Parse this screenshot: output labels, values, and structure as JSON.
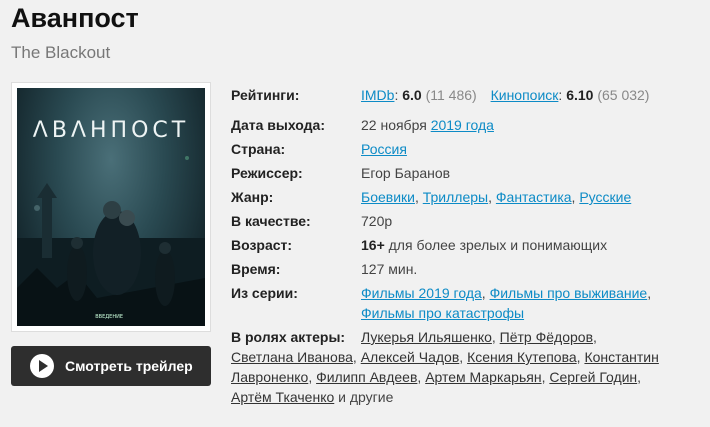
{
  "movie": {
    "title": "Аванпост",
    "original_title": "The Blackout",
    "poster_title": "ΛВΛНПОСТ",
    "poster_badge": "ВВЕДЕНИЕ"
  },
  "trailer_button": {
    "label": "Смотреть трейлер",
    "icon": "play-icon"
  },
  "ratings": {
    "label": "Рейтинги:",
    "imdb_name": "IMDb",
    "imdb_score": "6.0",
    "imdb_votes": "(11 486)",
    "kp_name": "Кинопоиск",
    "kp_score": "6.10",
    "kp_votes": "(65 032)"
  },
  "release": {
    "label": "Дата выхода:",
    "date": "22 ноября",
    "year_link": "2019 года"
  },
  "country": {
    "label": "Страна:",
    "value": "Россия"
  },
  "director": {
    "label": "Режиссер:",
    "value": "Егор Баранов"
  },
  "genre": {
    "label": "Жанр:",
    "items": [
      "Боевики",
      "Триллеры",
      "Фантастика",
      "Русские"
    ]
  },
  "quality": {
    "label": "В качестве:",
    "value": "720p"
  },
  "age": {
    "label": "Возраст:",
    "rating": "16+",
    "text": "для более зрелых и понимающих"
  },
  "duration": {
    "label": "Время:",
    "value": "127 мин."
  },
  "series": {
    "label": "Из серии:",
    "items": [
      "Фильмы 2019 года",
      "Фильмы про выживание",
      "Фильмы про катастрофы"
    ]
  },
  "cast": {
    "label": "В ролях актеры:",
    "actors": [
      "Лукерья Ильяшенко",
      "Пётр Фёдоров",
      "Светлана Иванова",
      "Алексей Чадов",
      "Ксения Кутепова",
      "Константин Лавроненко",
      "Филипп Авдеев",
      "Артем Маркарьян",
      "Сергей Годин",
      "Артём Ткаченко"
    ],
    "tail": "и другие"
  },
  "colors": {
    "link": "#0d8bc6",
    "button_bg": "#2e2e2e",
    "page_bg": "#f1f1f1"
  }
}
